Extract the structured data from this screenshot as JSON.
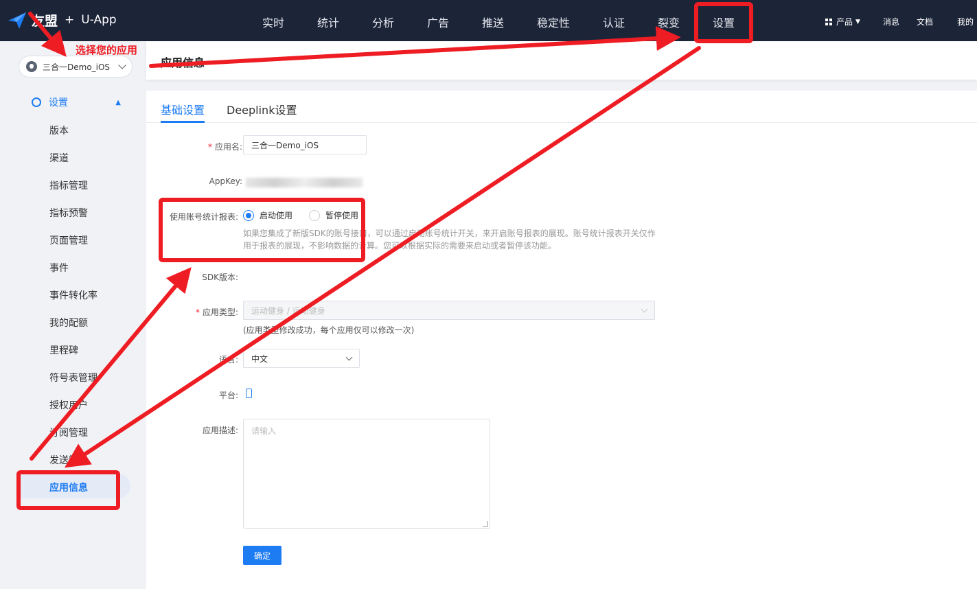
{
  "header": {
    "brand": "友盟",
    "plus": "+",
    "product": "U-App",
    "nav": [
      "实时",
      "统计",
      "分析",
      "广告",
      "推送",
      "稳定性",
      "认证",
      "裂变",
      "设置"
    ],
    "right": {
      "products": "产品",
      "messages": "消息",
      "docs": "文档",
      "mine": "我的"
    }
  },
  "sidebar": {
    "app_name": "三合一Demo_iOS",
    "group": "设置",
    "items": [
      "版本",
      "渠道",
      "指标管理",
      "指标预警",
      "页面管理",
      "事件",
      "事件转化率",
      "我的配额",
      "里程碑",
      "符号表管理",
      "授权用户",
      "订阅管理",
      "发送策略",
      "应用信息"
    ],
    "active_item": "应用信息"
  },
  "page": {
    "title": "应用信息"
  },
  "tabs": [
    "基础设置",
    "Deeplink设置"
  ],
  "form": {
    "app_name_label": "应用名:",
    "app_name_value": "三合一Demo_iOS",
    "appkey_label": "AppKey:",
    "account_label": "使用账号统计报表:",
    "radio_on": "启动使用",
    "radio_off": "暂停使用",
    "account_help": "如果您集成了新版SDK的账号接口，可以通过启动账号统计开关，来开启账号报表的展现。账号统计报表开关仅作用于报表的展现，不影响数据的计算。您可以根据实际的需要来启动或者暂停该功能。",
    "sdk_label": "SDK版本:",
    "type_label": "应用类型:",
    "type_value": "运动健身 / 运动健身",
    "type_note": "(应用类型修改成功，每个应用仅可以修改一次)",
    "lang_label": "语言:",
    "lang_value": "中文",
    "platform_label": "平台:",
    "desc_label": "应用描述:",
    "desc_placeholder": "请输入",
    "submit": "确定"
  },
  "annotation": {
    "text": "选择您的应用",
    "color": "#ee1d24"
  },
  "colors": {
    "topbar": "#1c2438",
    "primary": "#1e7cf2",
    "annotation": "#ee1d24"
  }
}
